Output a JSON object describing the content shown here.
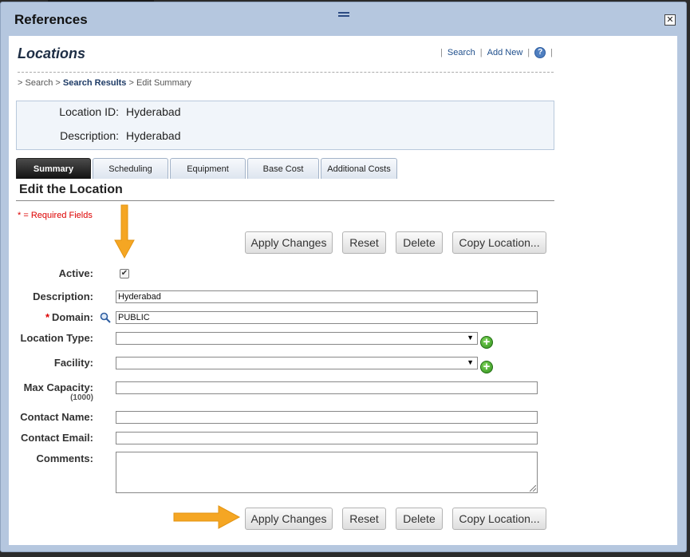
{
  "dialog": {
    "title": "References",
    "close_icon": "close-icon",
    "close_glyph": "✕"
  },
  "page": {
    "title": "Locations"
  },
  "top_links": {
    "search": "Search",
    "add_new": "Add New",
    "help_glyph": "?"
  },
  "breadcrumb": {
    "prefix1": ">",
    "search": "Search",
    "prefix2": ">",
    "results": "Search Results",
    "prefix3": ">",
    "current": "Edit Summary"
  },
  "info": {
    "location_id_label": "Location ID:",
    "location_id_value": "Hyderabad",
    "description_label": "Description:",
    "description_value": "Hyderabad"
  },
  "tabs": [
    "Summary",
    "Scheduling",
    "Equipment",
    "Base Cost",
    "Additional Costs"
  ],
  "active_tab": "Summary",
  "section": {
    "title": "Edit the Location",
    "required_note": "* = Required Fields"
  },
  "buttons": {
    "apply": "Apply Changes",
    "reset": "Reset",
    "delete": "Delete",
    "copy": "Copy Location..."
  },
  "form": {
    "active_label": "Active:",
    "active_checked": true,
    "check_glyph": "✔",
    "description_label": "Description:",
    "description_value": "Hyderabad",
    "domain_star": "*",
    "domain_label": "Domain:",
    "domain_value": "PUBLIC",
    "location_type_label": "Location Type:",
    "location_type_value": "",
    "facility_label": "Facility:",
    "facility_value": "",
    "max_capacity_label": "Max Capacity:",
    "max_capacity_hint": "(1000)",
    "max_capacity_value": "",
    "contact_name_label": "Contact Name:",
    "contact_name_value": "",
    "contact_email_label": "Contact Email:",
    "contact_email_value": "",
    "comments_label": "Comments:",
    "comments_value": "",
    "add_glyph": "+",
    "dropdown_glyph": "▼"
  },
  "colors": {
    "accent_arrow": "#f5a623",
    "dialog_frame": "#b5c7df",
    "link": "#1f4f8c",
    "required": "#dd0000"
  }
}
